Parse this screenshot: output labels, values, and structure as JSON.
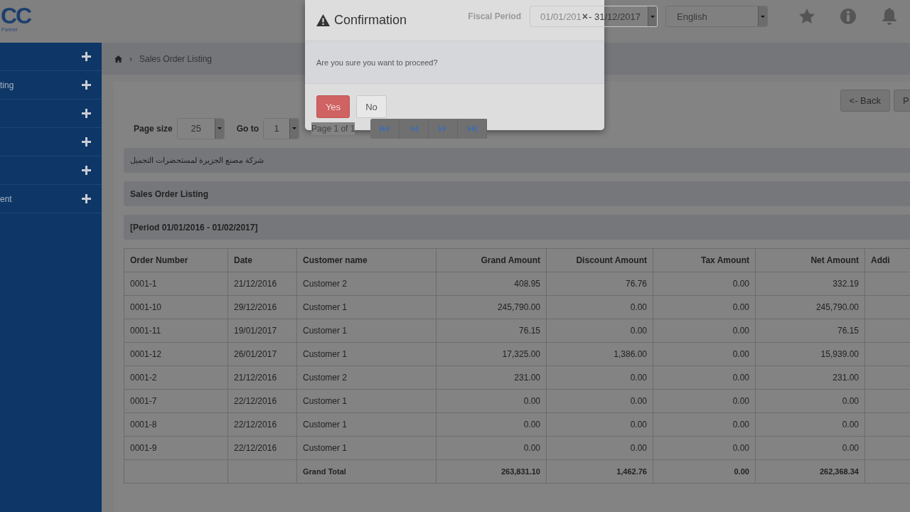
{
  "logo": {
    "mark": "CC",
    "tagline": "Partner"
  },
  "header": {
    "fiscal_period_label": "Fiscal Period",
    "fiscal_period_start": "01/01/201",
    "clear": "×",
    "fiscal_period_end": "- 31/12/2017",
    "language": "English"
  },
  "sidebar": {
    "items": [
      {
        "expandable": true
      },
      {
        "label": "ting",
        "expandable": true
      },
      {
        "expandable": true
      },
      {
        "expandable": true
      },
      {
        "expandable": true
      },
      {
        "label": "ent",
        "expandable": true
      }
    ]
  },
  "breadcrumb": {
    "separator": "›",
    "current": "Sales Order Listing"
  },
  "actions": [
    "<- Back",
    "P"
  ],
  "paging": {
    "page_size_label": "Page size",
    "page_size": "25",
    "goto_label": "Go to",
    "goto": "1",
    "page_info": "Page 1 of 1"
  },
  "company": "شركة مصنع الجزيرة لمستحضرات التجميل",
  "report_title": "Sales Order Listing",
  "period": "[Period 01/01/2016 - 01/02/2017]",
  "table": {
    "columns": [
      "Order Number",
      "Date",
      "Customer name",
      "Grand Amount",
      "Discount Amount",
      "Tax Amount",
      "Net Amount",
      "Addi"
    ],
    "rows": [
      [
        "0001-1",
        "21/12/2016",
        "Customer 2",
        "408.95",
        "76.76",
        "0.00",
        "332.19"
      ],
      [
        "0001-10",
        "29/12/2016",
        "Customer 1",
        "245,790.00",
        "0.00",
        "0.00",
        "245,790.00"
      ],
      [
        "0001-11",
        "19/01/2017",
        "Customer 1",
        "76.15",
        "0.00",
        "0.00",
        "76.15"
      ],
      [
        "0001-12",
        "26/01/2017",
        "Customer 1",
        "17,325.00",
        "1,386.00",
        "0.00",
        "15,939.00"
      ],
      [
        "0001-2",
        "21/12/2016",
        "Customer 2",
        "231.00",
        "0.00",
        "0.00",
        "231.00"
      ],
      [
        "0001-7",
        "22/12/2016",
        "Customer 1",
        "0.00",
        "0.00",
        "0.00",
        "0.00"
      ],
      [
        "0001-8",
        "22/12/2016",
        "Customer 1",
        "0.00",
        "0.00",
        "0.00",
        "0.00"
      ],
      [
        "0001-9",
        "22/12/2016",
        "Customer 1",
        "0.00",
        "0.00",
        "0.00",
        "0.00"
      ]
    ],
    "total": {
      "label": "Grand Total",
      "values": [
        "263,831.10",
        "1,462.76",
        "0.00",
        "262,368.34"
      ]
    }
  },
  "dialog": {
    "title": "Confirmation",
    "message": "Are you sure you want to proceed?",
    "buttons": [
      {
        "label": "Yes",
        "kind": "primary"
      },
      {
        "label": "No",
        "kind": "default"
      }
    ]
  }
}
